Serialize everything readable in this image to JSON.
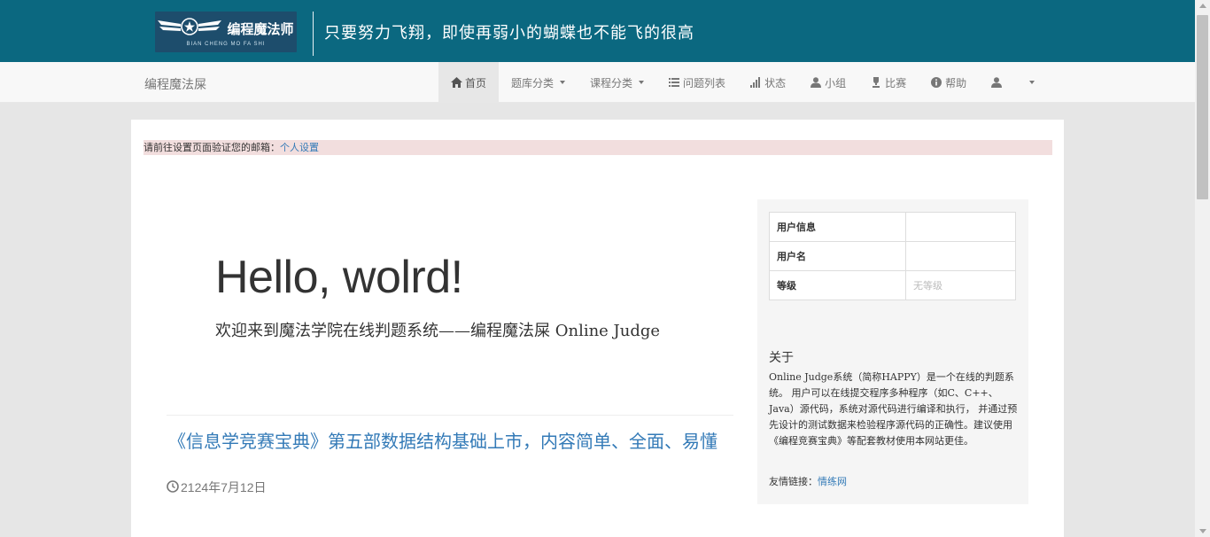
{
  "header": {
    "logo_cn": "编程魔法师",
    "logo_en": "BIAN CHENG MO FA SHI",
    "slogan": "只要努力飞翔，即使再弱小的蝴蝶也不能飞的很高"
  },
  "navbar": {
    "brand": "编程魔法屎",
    "items": [
      {
        "label": "首页",
        "icon": "home-icon",
        "active": true
      },
      {
        "label": "题库分类",
        "dropdown": true
      },
      {
        "label": "课程分类",
        "dropdown": true
      },
      {
        "label": "问题列表",
        "icon": "list-icon"
      },
      {
        "label": "状态",
        "icon": "signal-icon"
      },
      {
        "label": "小组",
        "icon": "user-icon"
      },
      {
        "label": "比赛",
        "icon": "trophy-icon"
      },
      {
        "label": "帮助",
        "icon": "info-icon"
      },
      {
        "label": "",
        "icon": "user-icon",
        "dropdown": true
      }
    ]
  },
  "alert": {
    "text": "请前往设置页面验证您的邮箱：",
    "link": "个人设置"
  },
  "jumbotron": {
    "title": "Hello, wolrd!",
    "subtitle": "欢迎来到魔法学院在线判题系统——编程魔法屎 Online Judge"
  },
  "news": {
    "title": "《信息学竞赛宝典》第五部数据结构基础上市，内容简单、全面、易懂",
    "date": "2124年7月12日"
  },
  "user_info": {
    "rows": [
      {
        "key": "用户信息",
        "value": ""
      },
      {
        "key": "用户名",
        "value": ""
      },
      {
        "key": "等级",
        "value": "无等级"
      }
    ]
  },
  "about": {
    "heading": "关于",
    "text": "Online Judge系统（简称HAPPY）是一个在线的判题系统。 用户可以在线提交程序多种程序（如C、C++、Java）源代码，系统对源代码进行编译和执行， 并通过预先设计的测试数据来检验程序源代码的正确性。建议使用《编程竞赛宝典》等配套教材使用本网站更佳。",
    "links_label": "友情链接：",
    "link": "情练网"
  },
  "colors": {
    "topbar": "#0b6880",
    "logo_bg": "#1d4d6c",
    "link": "#337ab7",
    "alert_bg": "#f2dede"
  }
}
